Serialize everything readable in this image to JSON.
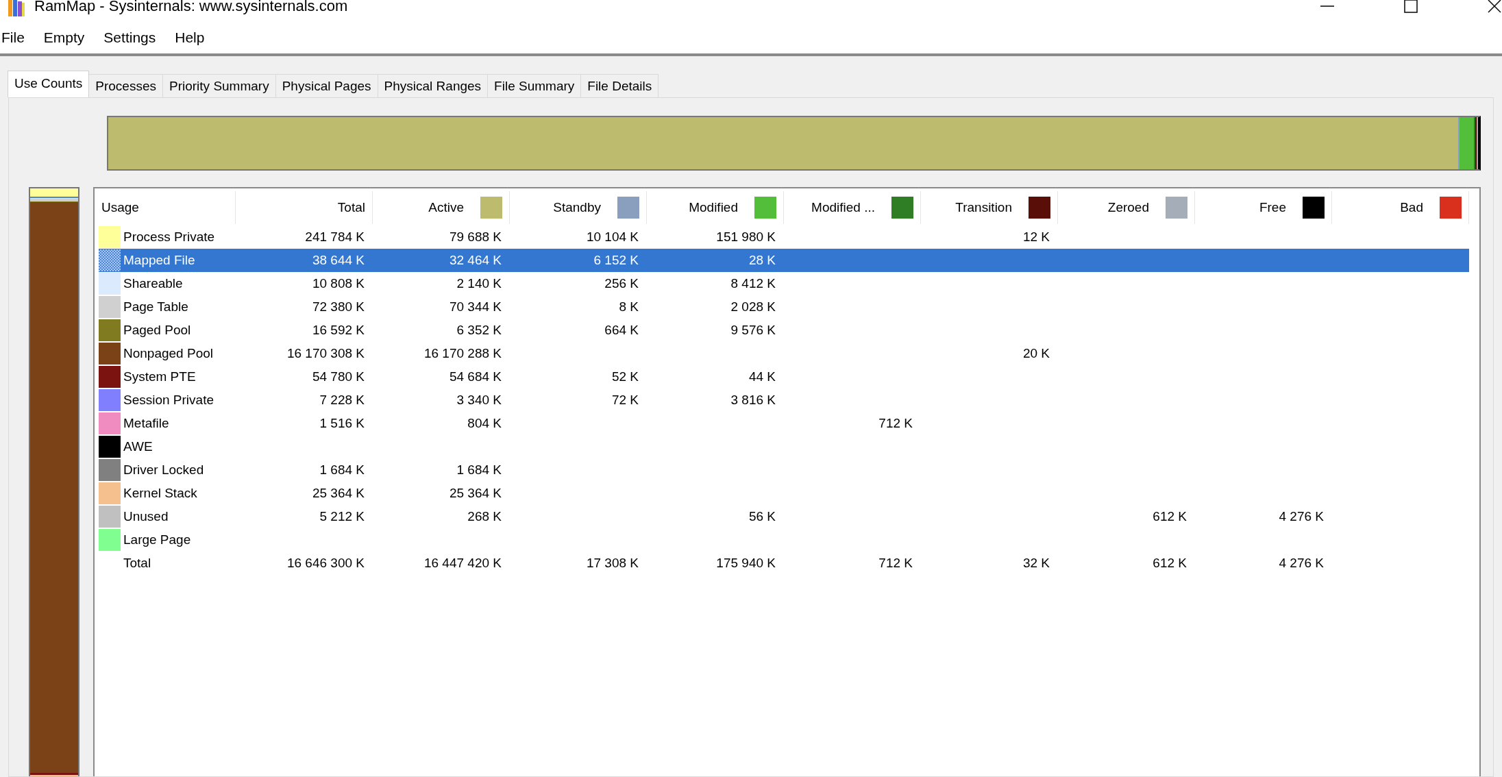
{
  "window": {
    "title": "RamMap - Sysinternals: www.sysinternals.com"
  },
  "menu": [
    "File",
    "Empty",
    "Settings",
    "Help"
  ],
  "tabs": [
    {
      "label": "Use Counts",
      "selected": true
    },
    {
      "label": "Processes",
      "selected": false
    },
    {
      "label": "Priority Summary",
      "selected": false
    },
    {
      "label": "Physical Pages",
      "selected": false
    },
    {
      "label": "Physical Ranges",
      "selected": false
    },
    {
      "label": "File Summary",
      "selected": false
    },
    {
      "label": "File Details",
      "selected": false
    }
  ],
  "table": {
    "columns": [
      {
        "label": "Usage"
      },
      {
        "label": "Total"
      },
      {
        "label": "Active",
        "color": "#bdbb6e"
      },
      {
        "label": "Standby",
        "color": "#8a9fbd"
      },
      {
        "label": "Modified",
        "color": "#52be3a"
      },
      {
        "label": "Modified ...",
        "color": "#2f7d24"
      },
      {
        "label": "Transition",
        "color": "#5a0e08"
      },
      {
        "label": "Zeroed",
        "color": "#a5aeb8"
      },
      {
        "label": "Free",
        "color": "#000000"
      },
      {
        "label": "Bad",
        "color": "#d9301e"
      }
    ],
    "rows": [
      {
        "color": "#ffff99",
        "selected": false,
        "cells": [
          "Process Private",
          "241 784 K",
          "79 688 K",
          "10 104 K",
          "151 980 K",
          "",
          "12 K",
          "",
          "",
          ""
        ]
      },
      {
        "color": "#4a86d8",
        "selected": true,
        "cells": [
          "Mapped File",
          "38 644 K",
          "32 464 K",
          "6 152 K",
          "28 K",
          "",
          "",
          "",
          "",
          ""
        ]
      },
      {
        "color": "#dbeafc",
        "selected": false,
        "cells": [
          "Shareable",
          "10 808 K",
          "2 140 K",
          "256 K",
          "8 412 K",
          "",
          "",
          "",
          "",
          ""
        ]
      },
      {
        "color": "#d0d0d0",
        "selected": false,
        "cells": [
          "Page Table",
          "72 380 K",
          "70 344 K",
          "8 K",
          "2 028 K",
          "",
          "",
          "",
          "",
          ""
        ]
      },
      {
        "color": "#807b21",
        "selected": false,
        "cells": [
          "Paged Pool",
          "16 592 K",
          "6 352 K",
          "664 K",
          "9 576 K",
          "",
          "",
          "",
          "",
          ""
        ]
      },
      {
        "color": "#7a4216",
        "selected": false,
        "cells": [
          "Nonpaged Pool",
          "16 170 308 K",
          "16 170 288 K",
          "",
          "",
          "",
          "20 K",
          "",
          "",
          ""
        ]
      },
      {
        "color": "#7b1410",
        "selected": false,
        "cells": [
          "System PTE",
          "54 780 K",
          "54 684 K",
          "52 K",
          "44 K",
          "",
          "",
          "",
          "",
          ""
        ]
      },
      {
        "color": "#8080ff",
        "selected": false,
        "cells": [
          "Session Private",
          "7 228 K",
          "3 340 K",
          "72 K",
          "3 816 K",
          "",
          "",
          "",
          "",
          ""
        ]
      },
      {
        "color": "#f08cc0",
        "selected": false,
        "cells": [
          "Metafile",
          "1 516 K",
          "804 K",
          "",
          "",
          "712 K",
          "",
          "",
          "",
          ""
        ]
      },
      {
        "color": "#000000",
        "selected": false,
        "cells": [
          "AWE",
          "",
          "",
          "",
          "",
          "",
          "",
          "",
          "",
          ""
        ]
      },
      {
        "color": "#808080",
        "selected": false,
        "cells": [
          "Driver Locked",
          "1 684 K",
          "1 684 K",
          "",
          "",
          "",
          "",
          "",
          "",
          ""
        ]
      },
      {
        "color": "#f6c08e",
        "selected": false,
        "cells": [
          "Kernel Stack",
          "25 364 K",
          "25 364 K",
          "",
          "",
          "",
          "",
          "",
          "",
          ""
        ]
      },
      {
        "color": "#c0c0c0",
        "selected": false,
        "cells": [
          "Unused",
          "5 212 K",
          "268 K",
          "",
          "56 K",
          "",
          "",
          "612 K",
          "4 276 K",
          ""
        ]
      },
      {
        "color": "#80ff90",
        "selected": false,
        "cells": [
          "Large Page",
          "",
          "",
          "",
          "",
          "",
          "",
          "",
          "",
          ""
        ]
      }
    ],
    "total_row": {
      "cells": [
        "Total",
        "16 646 300 K",
        "16 447 420 K",
        "17 308 K",
        "175 940 K",
        "712 K",
        "32 K",
        "612 K",
        "4 276 K",
        ""
      ]
    }
  }
}
